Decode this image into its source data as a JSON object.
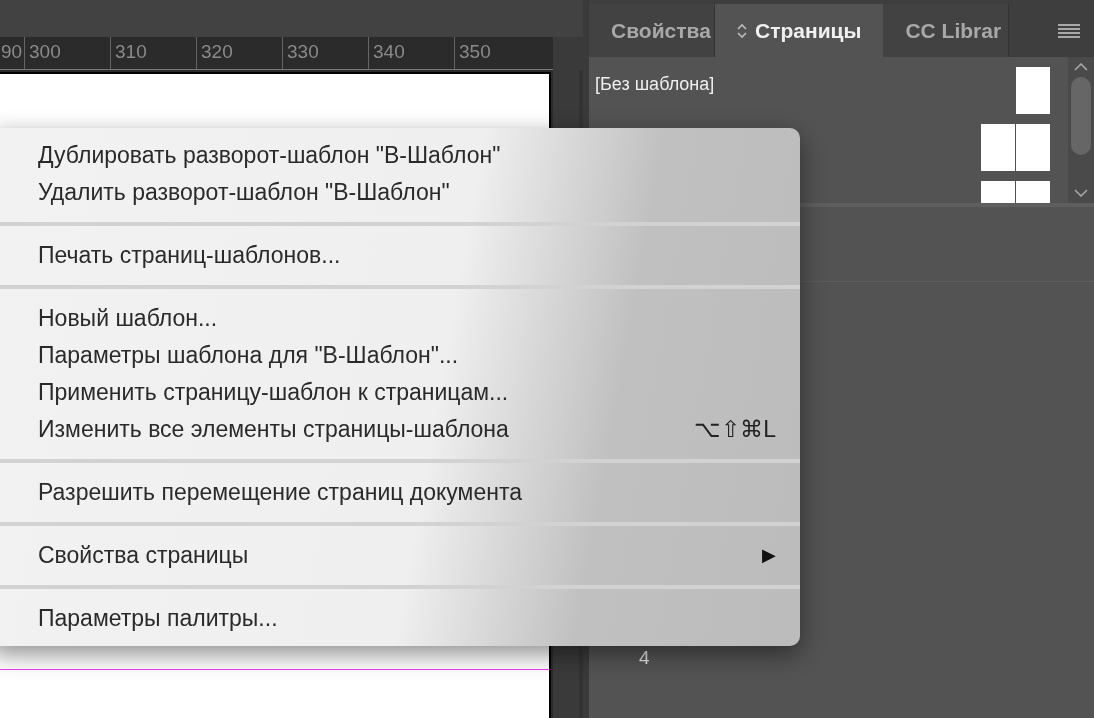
{
  "ruler": {
    "labels": [
      "90",
      "300",
      "310",
      "320",
      "330",
      "340",
      "350"
    ]
  },
  "panel": {
    "tabs": [
      {
        "label": "Свойства",
        "selected": false
      },
      {
        "label": "Страницы",
        "selected": true
      },
      {
        "label": "CC Librar",
        "selected": false
      }
    ],
    "templates": [
      {
        "label": "[Без шаблона]",
        "kind": "single"
      },
      {
        "kind": "spread"
      },
      {
        "kind": "spread"
      }
    ],
    "page_number": "4"
  },
  "menu": {
    "groups": [
      [
        {
          "label": "Дублировать разворот-шаблон \"В-Шаблон\"",
          "kind": "plain"
        },
        {
          "label": "Удалить разворот-шаблон \"В-Шаблон\"",
          "kind": "plain"
        }
      ],
      [
        {
          "label": "Печать страниц-шаблонов...",
          "kind": "plain"
        }
      ],
      [
        {
          "label": "Новый шаблон...",
          "kind": "plain"
        },
        {
          "label": "Параметры шаблона для \"В-Шаблон\"...",
          "kind": "plain"
        },
        {
          "label": "Применить страницу-шаблон к страницам...",
          "kind": "plain"
        },
        {
          "label": "Изменить все элементы страницы-шаблона",
          "kind": "shortcut",
          "shortcut": "⌥⇧⌘L"
        }
      ],
      [
        {
          "label": "Разрешить перемещение страниц документа",
          "kind": "plain"
        }
      ],
      [
        {
          "label": "Свойства страницы",
          "kind": "submenu",
          "arrow": "▶"
        }
      ],
      [
        {
          "label": "Параметры палитры...",
          "kind": "plain"
        }
      ]
    ]
  }
}
